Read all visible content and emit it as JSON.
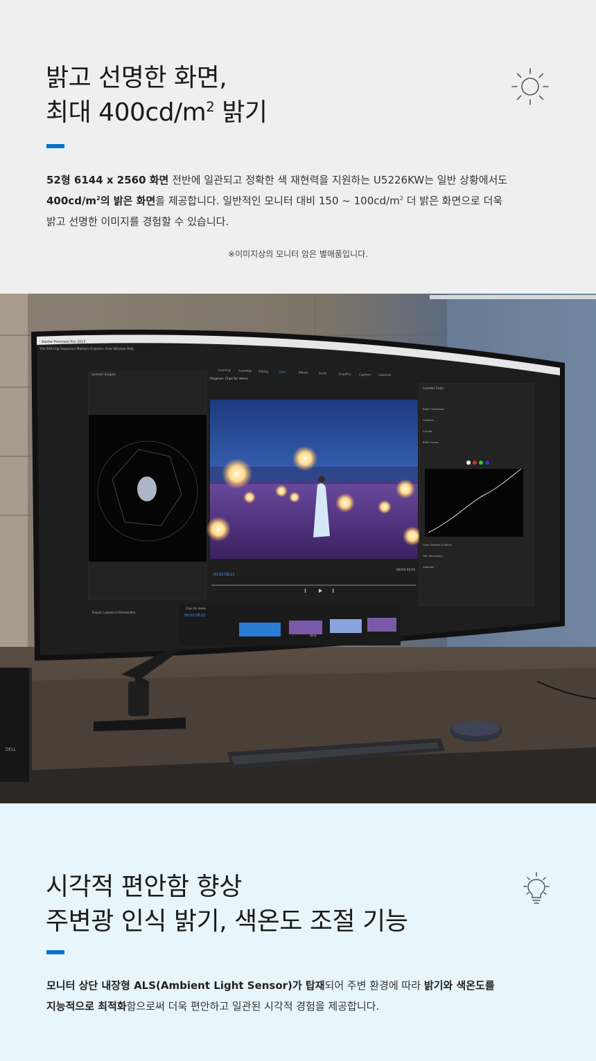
{
  "section1": {
    "headline_line1": "밝고 선명한 화면,",
    "headline_line2_prefix": "최대 400cd/m",
    "headline_line2_sup": "2",
    "headline_line2_suffix": " 밝기",
    "body_line1_bold": "52형 6144 x 2560 화면",
    "body_line1_rest": " 전반에 일관되고 정확한 색 재현력을 지원하는 U5226KW는 일반 상황에서도",
    "body_line2_bold_prefix": "400cd/m",
    "body_line2_bold_sup": "2",
    "body_line2_bold_suffix": "의 밝은 화면",
    "body_line2_mid": "을 제공합니다. 일반적인 모니터 대비 150 ~ 100cd/m",
    "body_line2_sup": "2",
    "body_line2_end": " 더 밝은 화면으로 더욱",
    "body_line3": "밝고 선명한 이미지를 경험할 수 있습니다.",
    "note": "※이미지상의 모니터 암은 별매품입니다.",
    "icon": "sun-icon"
  },
  "product_image": {
    "window_title": "Adobe Premiere Pro 2022",
    "menu": "File  Edit  Clip  Sequence  Markers  Graphics  View  Window  Help",
    "workspace_tabs": [
      "Learning",
      "Assembly",
      "Editing",
      "Color",
      "Effects",
      "Audio",
      "Graphics",
      "Captions",
      "Libraries"
    ],
    "scopes_label": "Lumetri Scopes",
    "program_label": "Program: Clips for demo",
    "lumetri_label": "Lumetri Color",
    "timecode": "00:02:58:21",
    "end_timecode": "00:03:42:01",
    "sequence_label": "Clips for demo",
    "project_label": "Project: Lumetri-in-PremierePro",
    "brand": "DELL",
    "panels": [
      "Basic Correction",
      "Creative",
      "Curves",
      "RGB Curves",
      "Color Wheels & Match",
      "HSL Secondary",
      "Vignette"
    ],
    "colors": {
      "accent": "#0672cb",
      "screen": "#1e1e1e"
    }
  },
  "section3": {
    "headline_line1": "시각적 편안함 향상",
    "headline_line2": "주변광 인식 밝기, 색온도 조절 기능",
    "body_line1_bold1": "모니터 상단 내장형 ALS(Ambient Light Sensor)가 탑재",
    "body_line1_mid": "되어 주변 환경에 따라 ",
    "body_line1_bold2": "밝기와 색온도를",
    "body_line2_bold": "지능적으로 최적화",
    "body_line2_rest": "함으로써 더욱 편안하고 일관된 시각적 경험을 제공합니다.",
    "icon": "lightbulb-icon"
  }
}
